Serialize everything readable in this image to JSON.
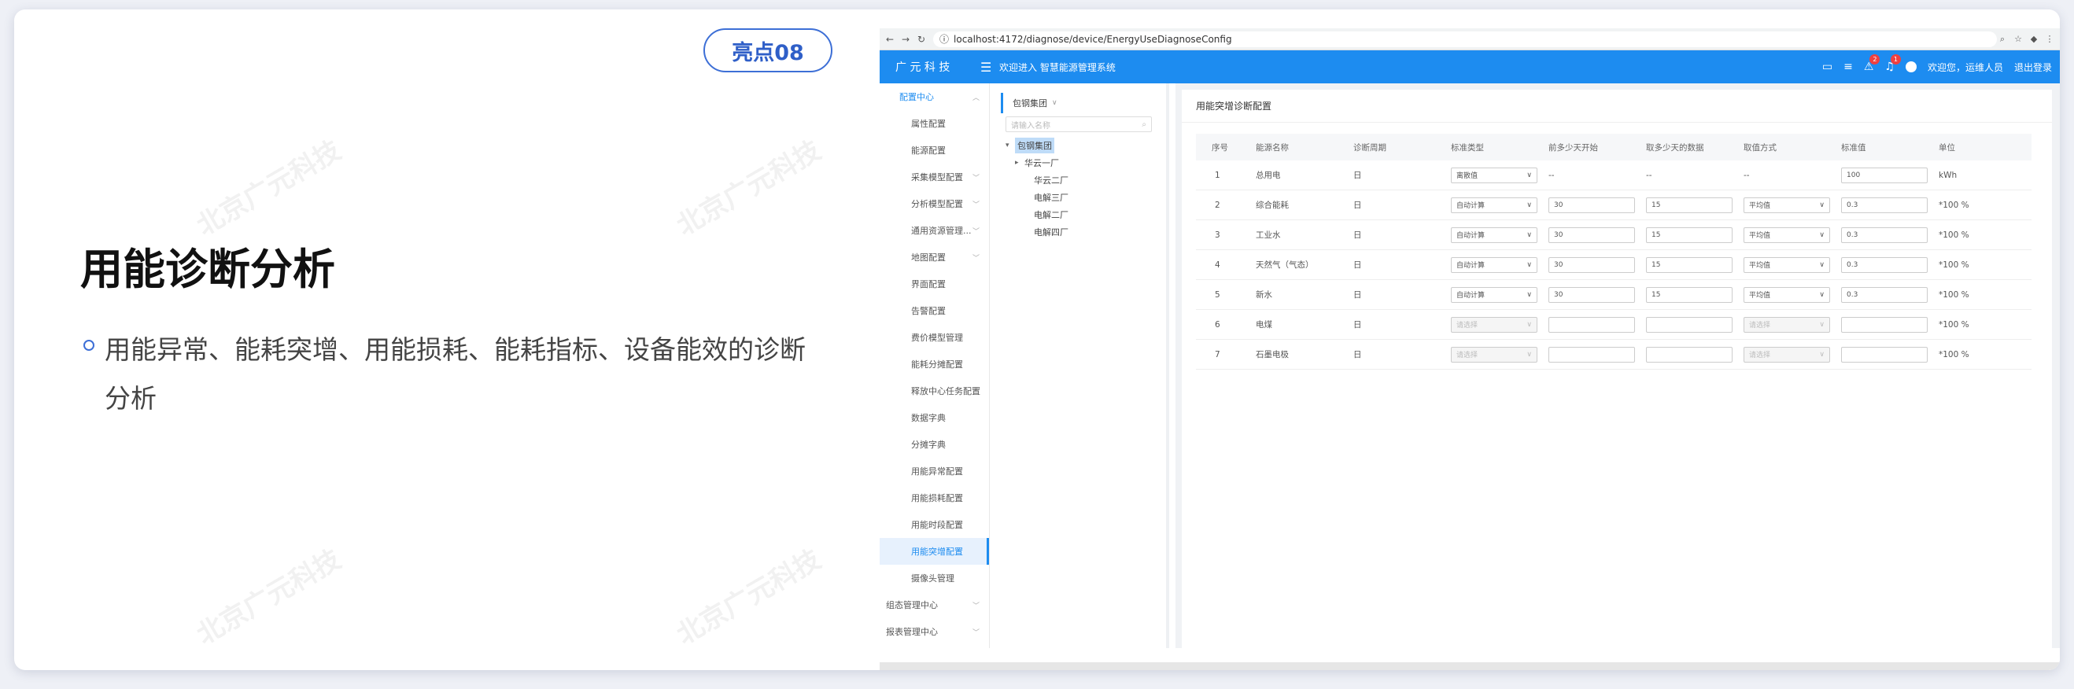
{
  "slide": {
    "badge": "亮点08",
    "heading": "用能诊断分析",
    "bullet": "用能异常、能耗突增、用能损耗、能耗指标、设备能效的诊断分析",
    "watermark": "北京广元科技"
  },
  "browser": {
    "url": "localhost:4172/diagnose/device/EnergyUseDiagnoseConfig"
  },
  "app": {
    "logo": "广 元 科 技",
    "welcome": "欢迎进入 智慧能源管理系统",
    "badge_warn": "2",
    "badge_bell": "1",
    "user": "欢迎您，运维人员",
    "logout": "退出登录",
    "sidebar": [
      {
        "label": "配置中心",
        "level": 1,
        "expanded": true,
        "blue": true
      },
      {
        "label": "属性配置"
      },
      {
        "label": "能源配置"
      },
      {
        "label": "采集模型配置",
        "caret": true
      },
      {
        "label": "分析模型配置",
        "caret": true
      },
      {
        "label": "通用资源管理...",
        "caret": true
      },
      {
        "label": "地图配置",
        "caret": true
      },
      {
        "label": "界面配置"
      },
      {
        "label": "告警配置"
      },
      {
        "label": "费价模型管理"
      },
      {
        "label": "能耗分摊配置"
      },
      {
        "label": "释放中心任务配置"
      },
      {
        "label": "数据字典"
      },
      {
        "label": "分摊字典"
      },
      {
        "label": "用能异常配置"
      },
      {
        "label": "用能损耗配置"
      },
      {
        "label": "用能时段配置"
      },
      {
        "label": "用能突增配置",
        "active": true
      },
      {
        "label": "摄像头管理"
      },
      {
        "label": "组态管理中心",
        "level": 1,
        "caret": true
      },
      {
        "label": "报表管理中心",
        "level": 1,
        "caret": true
      }
    ],
    "tree": {
      "header": "包钢集团",
      "search_placeholder": "请输入名称",
      "nodes": [
        {
          "label": "包钢集团",
          "depth": 0,
          "selected": true,
          "arrow": "▾"
        },
        {
          "label": "华云一厂",
          "depth": 1,
          "arrow": "▸"
        },
        {
          "label": "华云二厂",
          "depth": 2
        },
        {
          "label": "电解三厂",
          "depth": 2
        },
        {
          "label": "电解二厂",
          "depth": 2
        },
        {
          "label": "电解四厂",
          "depth": 2
        }
      ]
    },
    "panel_title": "用能突增诊断配置",
    "columns": [
      "序号",
      "能源名称",
      "诊断周期",
      "标准类型",
      "前多少天开始",
      "取多少天的数据",
      "取值方式",
      "标准值",
      "单位"
    ],
    "rows": [
      {
        "no": "1",
        "name": "总用电",
        "cycle": "日",
        "type": "离散值",
        "start": "--",
        "days": "--",
        "method": "--",
        "value": "100",
        "unit": "kWh",
        "dis": false
      },
      {
        "no": "2",
        "name": "综合能耗",
        "cycle": "日",
        "type": "自动计算",
        "start": "30",
        "days": "15",
        "method": "平均值",
        "value": "0.3",
        "unit": "*100 %",
        "dis": false
      },
      {
        "no": "3",
        "name": "工业水",
        "cycle": "日",
        "type": "自动计算",
        "start": "30",
        "days": "15",
        "method": "平均值",
        "value": "0.3",
        "unit": "*100 %",
        "dis": false
      },
      {
        "no": "4",
        "name": "天然气（气态）",
        "cycle": "日",
        "type": "自动计算",
        "start": "30",
        "days": "15",
        "method": "平均值",
        "value": "0.3",
        "unit": "*100 %",
        "dis": false
      },
      {
        "no": "5",
        "name": "新水",
        "cycle": "日",
        "type": "自动计算",
        "start": "30",
        "days": "15",
        "method": "平均值",
        "value": "0.3",
        "unit": "*100 %",
        "dis": false
      },
      {
        "no": "6",
        "name": "电煤",
        "cycle": "日",
        "type": "请选择",
        "start": "",
        "days": "",
        "method": "请选择",
        "value": "",
        "unit": "*100 %",
        "dis": true
      },
      {
        "no": "7",
        "name": "石墨电极",
        "cycle": "日",
        "type": "请选择",
        "start": "",
        "days": "",
        "method": "请选择",
        "value": "",
        "unit": "*100 %",
        "dis": true
      }
    ]
  }
}
